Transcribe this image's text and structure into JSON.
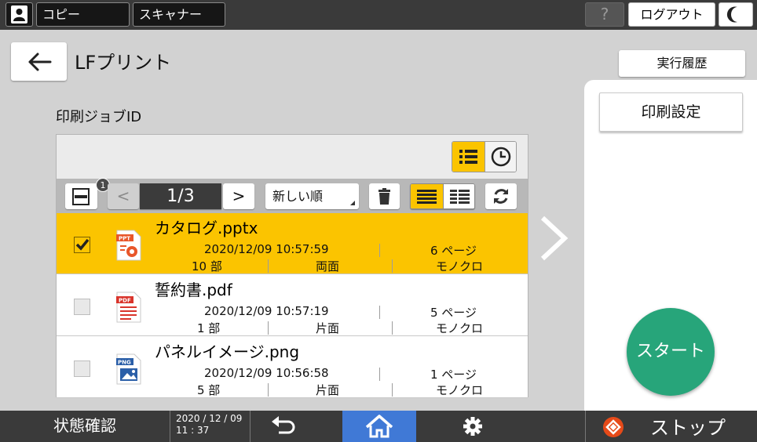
{
  "topbar": {
    "copy_label": "コピー",
    "scanner_label": "スキャナー",
    "help_label": "?",
    "logout_label": "ログアウト"
  },
  "header": {
    "title": "LFプリント",
    "history_label": "実行履歴"
  },
  "section_label": "印刷ジョブID",
  "toolbar": {
    "selected_count": "1",
    "prev_label": "<",
    "page_indicator": "1/3",
    "next_label": ">",
    "sort_label": "新しい順"
  },
  "jobs": [
    {
      "name": "カタログ.pptx",
      "type": "PPT",
      "date": "2020/12/09 10:57:59",
      "pages": "6 ページ",
      "copies": "10 部",
      "sides": "両面",
      "color": "モノクロ",
      "selected": true
    },
    {
      "name": "誓約書.pdf",
      "type": "PDF",
      "date": "2020/12/09 10:57:19",
      "pages": "5 ページ",
      "copies": "1 部",
      "sides": "片面",
      "color": "モノクロ",
      "selected": false
    },
    {
      "name": "パネルイメージ.png",
      "type": "PNG",
      "date": "2020/12/09 10:56:58",
      "pages": "1 ページ",
      "copies": "5 部",
      "sides": "片面",
      "color": "モノクロ",
      "selected": false
    }
  ],
  "right_panel": {
    "print_settings_label": "印刷設定",
    "start_label": "スタート"
  },
  "bottombar": {
    "status_label": "状態確認",
    "date": "2020 / 12 / 09",
    "time": "11 : 37",
    "stop_label": "ストップ"
  },
  "colors": {
    "accent_yellow": "#fbc400",
    "start_green": "#27a57a",
    "home_blue": "#4079d6",
    "stop_red": "#e64a19"
  }
}
